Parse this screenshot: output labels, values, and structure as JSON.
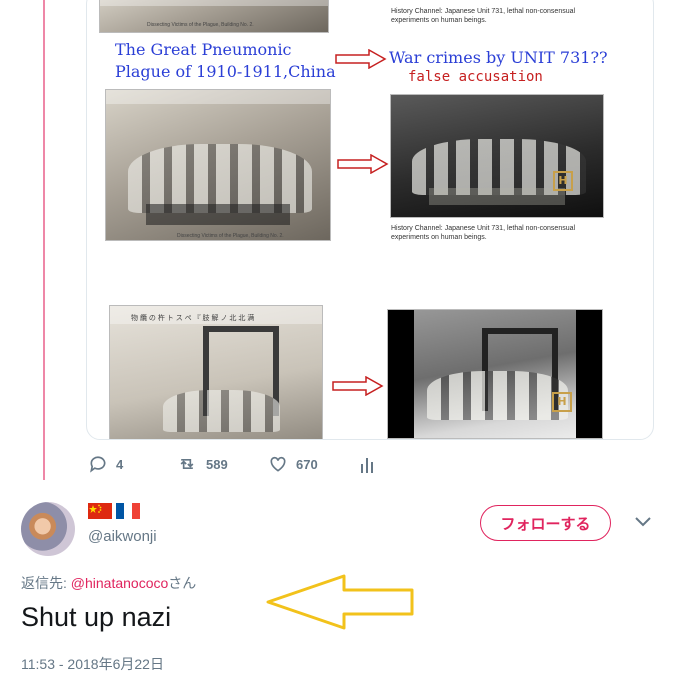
{
  "media": {
    "blue_caption_line1": "The Great Pneumonic",
    "blue_caption_line2": "Plague of 1910-1911,China",
    "blue_claim": "War crimes by UNIT 731??",
    "red_claim": "false accusation",
    "history_caption": "History Channel: Japanese Unit 731, lethal non-consensual experiments on human beings.",
    "history_caption_top": "History Channel: Japanese Unit 731, lethal non-consensual experiments on human beings.",
    "old_photo_caption_1": "Dissecting Victims of the Plague, Building No. 2.",
    "old_photo_caption_2": "Dissecting Victims of the Plague, Building No. 2.",
    "old_photo_header_3": "物 纜 の 杵 ト ス ペ 『 肢 解 ノ 北 北 满",
    "history_logo": "H"
  },
  "actions": {
    "reply_count": "4",
    "retweet_count": "589",
    "like_count": "670"
  },
  "reply": {
    "avatar_alt": "",
    "flags": [
      "cn-flag",
      "fr-flag"
    ],
    "handle": "@aikwonji",
    "follow_label": "フォローする",
    "reply_to_prefix": "返信先: ",
    "reply_to_handle": "@hinatanococo",
    "reply_to_suffix": "さん",
    "text": "Shut up nazi",
    "timestamp": "11:53 - 2018年6月22日"
  },
  "colors": {
    "accent": "#e0245e",
    "muted": "#657786",
    "text": "#14171a",
    "annotation_blue": "#2b3fd6",
    "annotation_red": "#c62020",
    "annotation_yellow": "#f2c21b"
  }
}
